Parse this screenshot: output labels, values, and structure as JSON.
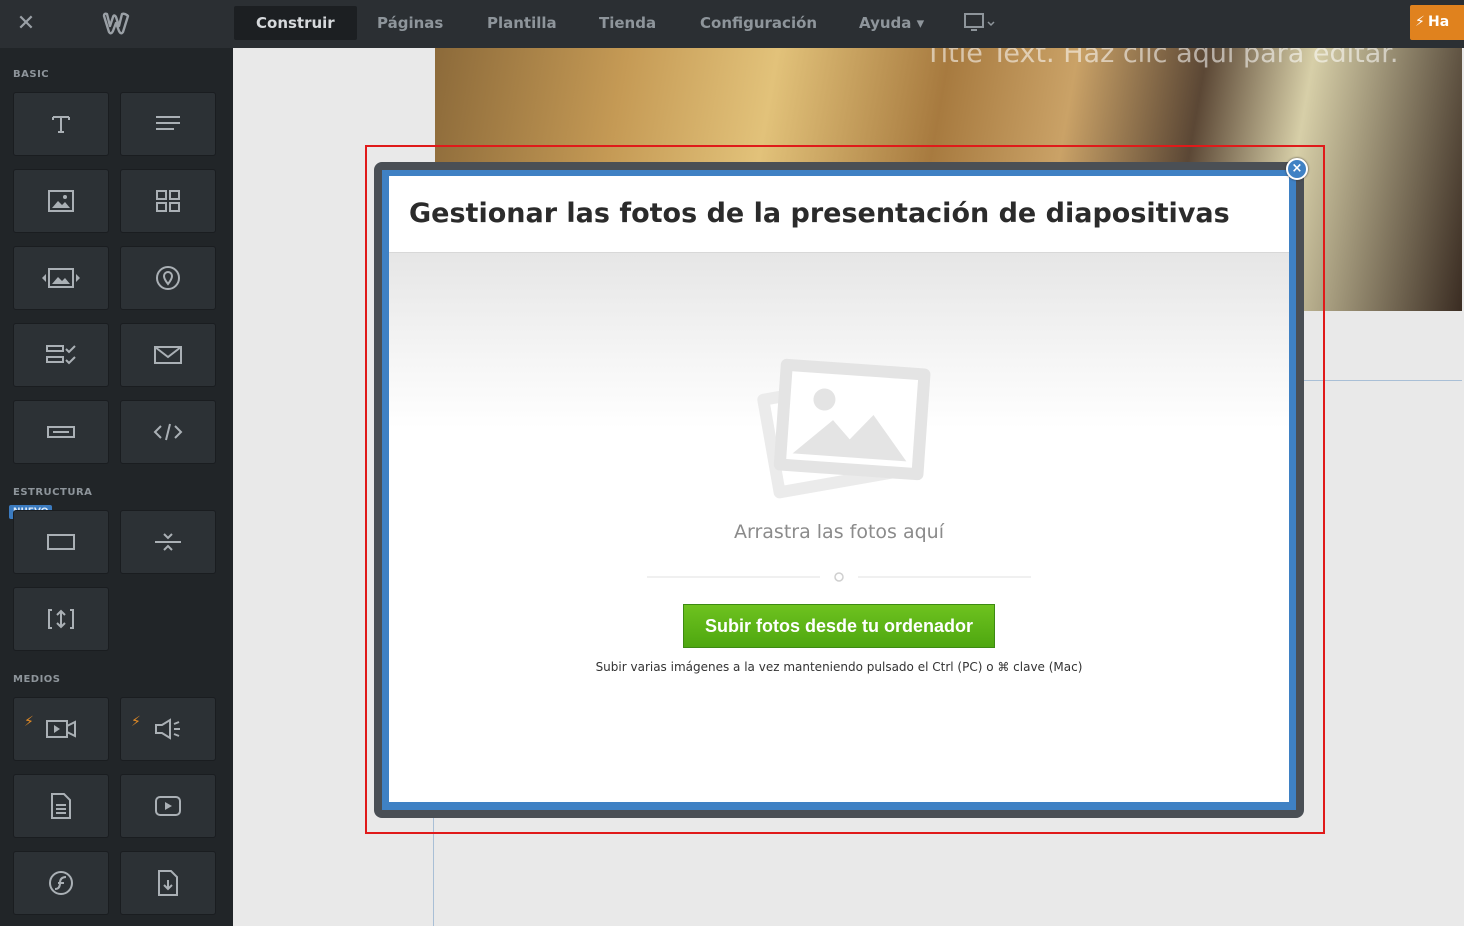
{
  "topbar": {
    "close_symbol": "✕",
    "logo": "weebly-logo-icon",
    "tabs": [
      {
        "label": "Construir",
        "active": true
      },
      {
        "label": "Páginas"
      },
      {
        "label": "Plantilla"
      },
      {
        "label": "Tienda"
      },
      {
        "label": "Configuración"
      },
      {
        "label": "Ayuda ▾"
      }
    ],
    "upgrade_label": "Ha"
  },
  "sidebar": {
    "sections": {
      "basic": "BASIC",
      "structure": "ESTRUCTURA",
      "media": "MEDIOS"
    },
    "new_badge": "NUEVO",
    "tiles": [
      "title-icon",
      "paragraph-icon",
      "image-icon",
      "gallery-icon",
      "slideshow-icon",
      "map-icon",
      "form-icon",
      "contact-form-icon",
      "button-icon",
      "embed-code-icon",
      "section-icon",
      "divider-icon",
      "spacer-icon",
      "video-icon",
      "audio-icon",
      "document-icon",
      "youtube-icon",
      "flash-icon",
      "file-icon"
    ]
  },
  "canvas": {
    "hero_title": "Title Text. Haz clic aquí para editar."
  },
  "modal": {
    "title": "Gestionar las fotos de la presentación de diapositivas",
    "drop_text": "Arrastra las fotos aquí",
    "upload_button": "Subir fotos desde tu ordenador",
    "hint": "Subir varias imágenes a la vez manteniendo pulsado el Ctrl (PC) o ⌘ clave (Mac)",
    "close_symbol": "×"
  },
  "colors": {
    "accent_blue": "#3f81c4",
    "upload_green": "#5bb316",
    "upgrade_orange": "#e0821e",
    "highlight_red": "#e01a1a"
  }
}
